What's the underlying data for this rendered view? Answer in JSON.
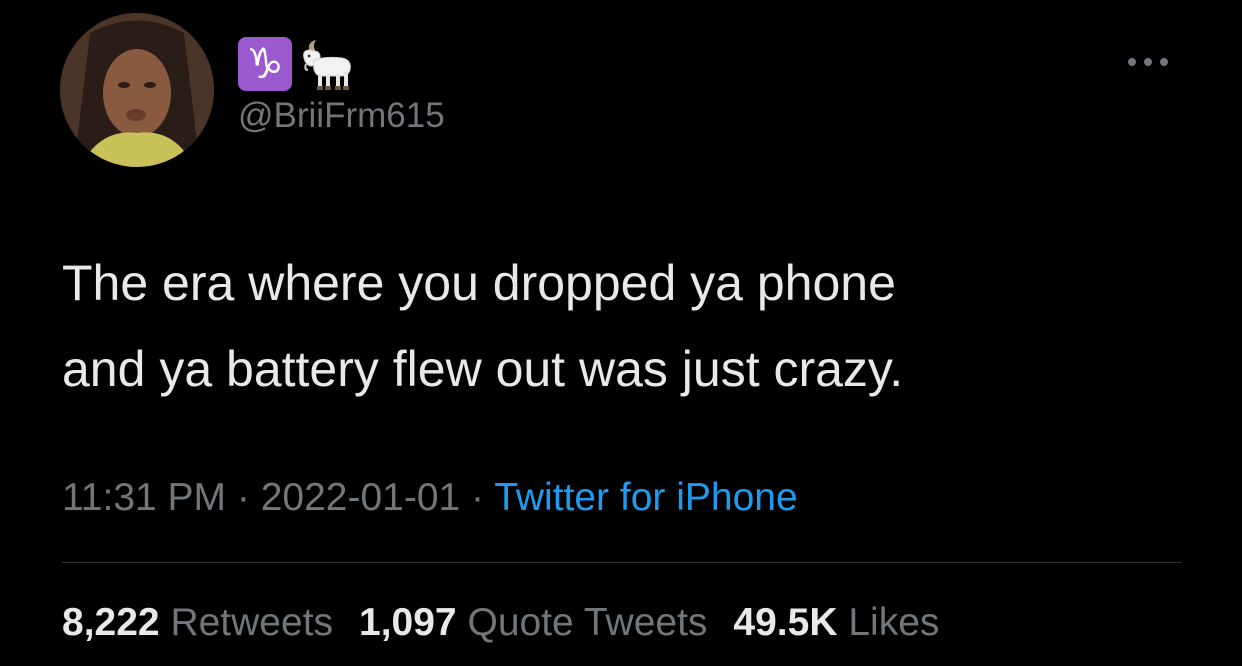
{
  "author": {
    "display_name_icons": [
      "capricorn-icon",
      "goat-icon"
    ],
    "zodiac_glyph": "♑",
    "handle": "@BriiFrm615"
  },
  "tweet": {
    "text": "The era where you dropped ya phone\nand ya battery flew out was just crazy.",
    "time": "11:31 PM",
    "separator": " · ",
    "date": "2022-01-01",
    "source": "Twitter for iPhone"
  },
  "stats": {
    "retweets": {
      "count": "8,222",
      "label": "Retweets"
    },
    "quotes": {
      "count": "1,097",
      "label": "Quote Tweets"
    },
    "likes": {
      "count": "49.5K",
      "label": "Likes"
    }
  },
  "colors": {
    "background": "#000000",
    "text": "#e7e9ea",
    "secondary": "#71767b",
    "link": "#1d9bf0",
    "divider": "#2f3336",
    "zodiac": "#9b59d0"
  }
}
